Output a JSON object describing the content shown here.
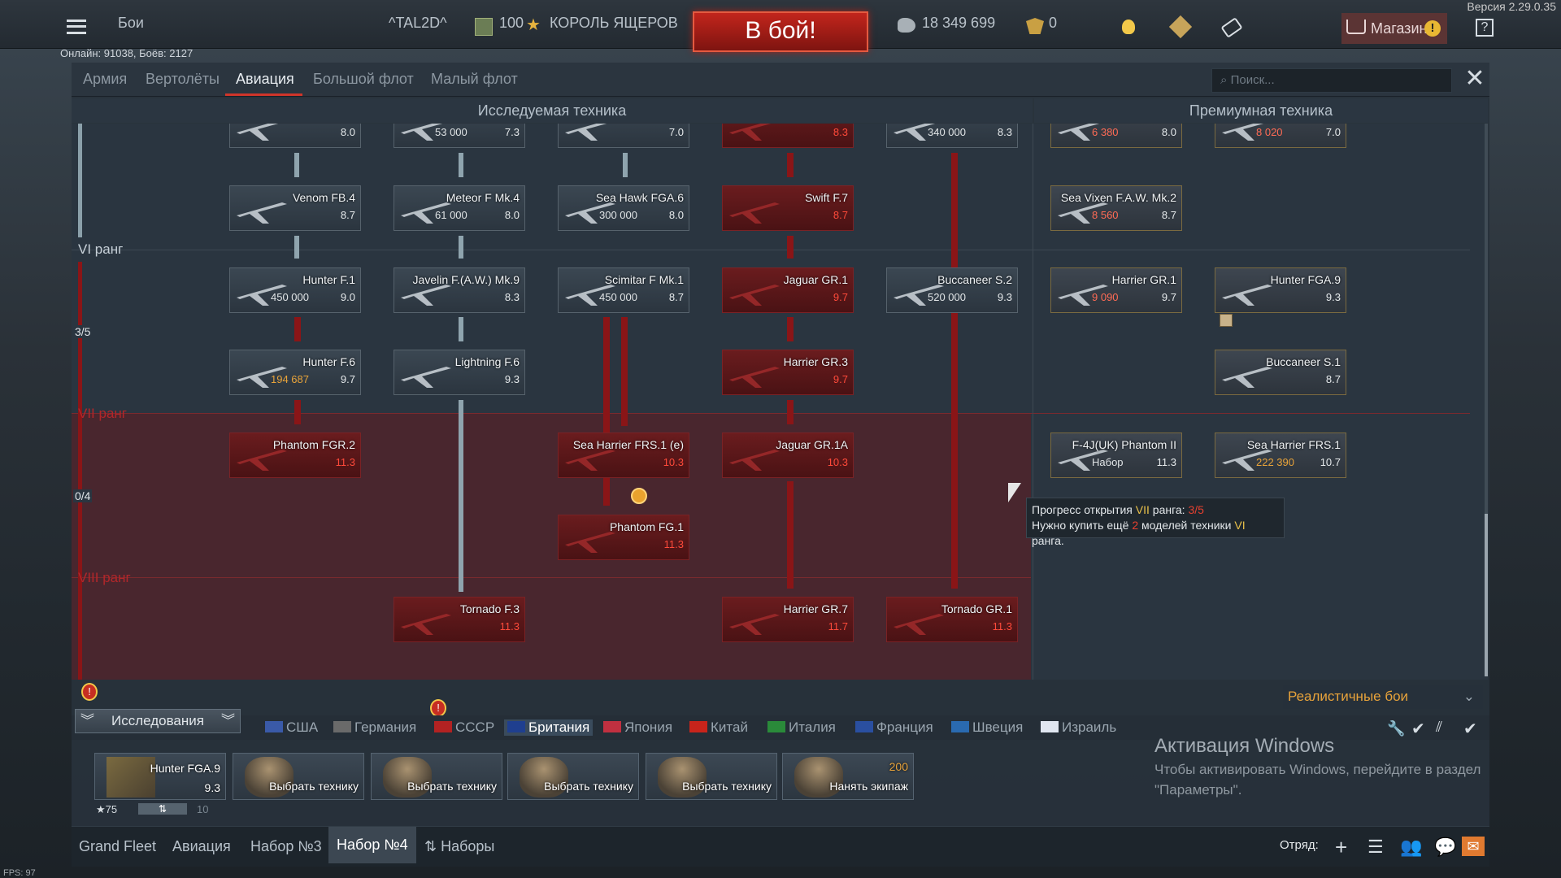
{
  "topbar": {
    "battles": "Бои",
    "nickname": "^TAL2D^",
    "level": "100",
    "title": "КОРОЛЬ ЯЩЕРОВ",
    "battle_button": "В бой!",
    "silver": "18 349 699",
    "gold": "0",
    "shop": "Магазин",
    "help": "?",
    "version": "Версия 2.29.0.35",
    "online": "Онлайн: 91038, Боёв: 2127"
  },
  "tabs": [
    "Армия",
    "Вертолёты",
    "Авиация",
    "Большой флот",
    "Малый флот"
  ],
  "active_tab": "Авиация",
  "search": {
    "placeholder": "Поиск..."
  },
  "sections": {
    "researched": "Исследуемая техника",
    "premium": "Премиумная техника"
  },
  "ranks": {
    "vi": "VI ранг",
    "vii": "VII ранг",
    "viii": "VIII ранг",
    "vi_progress": "3/5",
    "vii_progress": "0/4"
  },
  "cards": [
    {
      "id": "top1",
      "name": "",
      "cost": "",
      "br": "8.0",
      "red": false
    },
    {
      "id": "top2",
      "name": "",
      "cost": "53 000",
      "br": "7.3",
      "red": false
    },
    {
      "id": "top3",
      "name": "",
      "cost": "",
      "br": "7.0",
      "red": false
    },
    {
      "id": "top4",
      "name": "",
      "cost": "",
      "br": "8.3",
      "red": true
    },
    {
      "id": "top5",
      "name": "",
      "cost": "340 000",
      "br": "8.3",
      "red": false
    },
    {
      "id": "top6",
      "name": "",
      "cost": "6 380",
      "br": "8.0",
      "red": false
    },
    {
      "id": "top7",
      "name": "",
      "cost": "8 020",
      "br": "7.0",
      "red": false
    },
    {
      "id": "venom",
      "name": "Venom FB.4",
      "cost": "",
      "br": "8.7",
      "red": false
    },
    {
      "id": "meteor",
      "name": "Meteor F Mk.4",
      "cost": "61 000",
      "br": "8.0",
      "red": false
    },
    {
      "id": "seahawk",
      "name": "Sea Hawk FGA.6",
      "cost": "300 000",
      "br": "8.0",
      "red": false
    },
    {
      "id": "swift",
      "name": "Swift F.7",
      "cost": "",
      "br": "8.7",
      "red": true
    },
    {
      "id": "seavixen",
      "name": "Sea Vixen F.A.W. Mk.2",
      "cost": "8 560",
      "br": "8.7",
      "red": false
    },
    {
      "id": "hunterf1",
      "name": "Hunter F.1",
      "cost": "450 000",
      "br": "9.0",
      "red": false
    },
    {
      "id": "javelin",
      "name": "Javelin F.(A.W.) Mk.9",
      "cost": "",
      "br": "8.3",
      "red": false
    },
    {
      "id": "scimitar",
      "name": "Scimitar F Mk.1",
      "cost": "450 000",
      "br": "8.7",
      "red": false
    },
    {
      "id": "jaguar1",
      "name": "Jaguar GR.1",
      "cost": "",
      "br": "9.7",
      "red": true
    },
    {
      "id": "buccaneer2",
      "name": "Buccaneer S.2",
      "cost": "520 000",
      "br": "9.3",
      "red": false
    },
    {
      "id": "harriergr1",
      "name": "Harrier GR.1",
      "cost": "9 090",
      "br": "9.7",
      "red": false
    },
    {
      "id": "hunterfga9",
      "name": "Hunter FGA.9",
      "cost": "",
      "br": "9.3",
      "red": false
    },
    {
      "id": "hunterf6",
      "name": "Hunter F.6",
      "cost": "194 687",
      "br": "9.7",
      "red": false
    },
    {
      "id": "lightning",
      "name": "Lightning F.6",
      "cost": "",
      "br": "9.3",
      "red": false
    },
    {
      "id": "harriergr3",
      "name": "Harrier GR.3",
      "cost": "",
      "br": "9.7",
      "red": true
    },
    {
      "id": "buccaneer1",
      "name": "Buccaneer S.1",
      "cost": "",
      "br": "8.7",
      "red": false
    },
    {
      "id": "phantomfgr2",
      "name": "Phantom FGR.2",
      "cost": "",
      "br": "11.3",
      "red": true
    },
    {
      "id": "seaharriere",
      "name": "Sea Harrier FRS.1 (e)",
      "cost": "",
      "br": "10.3",
      "red": true
    },
    {
      "id": "jaguar1a",
      "name": "Jaguar GR.1A",
      "cost": "",
      "br": "10.3",
      "red": true
    },
    {
      "id": "f4j",
      "name": "F-4J(UK) Phantom II",
      "cost": "Набор",
      "br": "11.3",
      "red": false
    },
    {
      "id": "seaharrier",
      "name": "Sea Harrier FRS.1",
      "cost": "222 390",
      "br": "10.7",
      "red": false
    },
    {
      "id": "phantomfg1",
      "name": "Phantom FG.1",
      "cost": "",
      "br": "11.3",
      "red": true
    },
    {
      "id": "tornadof3",
      "name": "Tornado F.3",
      "cost": "",
      "br": "11.3",
      "red": true
    },
    {
      "id": "harriergr7",
      "name": "Harrier GR.7",
      "cost": "",
      "br": "11.7",
      "red": true
    },
    {
      "id": "tornadogr1",
      "name": "Tornado GR.1",
      "cost": "",
      "br": "11.3",
      "red": true
    }
  ],
  "tooltip": {
    "line1_a": "Прогресс открытия ",
    "line1_rank": "VII",
    "line1_b": " ранга: ",
    "line1_val": "3/5",
    "line2_a": "Нужно купить ещё ",
    "line2_num": "2",
    "line2_b": " моделей техники ",
    "line2_rank": "VI",
    "line2_c": " ранга."
  },
  "mode": "Реалистичные бои",
  "research_button": "Исследования",
  "countries": [
    "США",
    "Германия",
    "СССР",
    "Британия",
    "Япония",
    "Китай",
    "Италия",
    "Франция",
    "Швеция",
    "Израиль"
  ],
  "active_country": "Британия",
  "crew": [
    {
      "name": "Hunter FGA.9",
      "br": "9.3",
      "extra": "75",
      "extra2": "10"
    },
    {
      "name": "Выбрать технику"
    },
    {
      "name": "Выбрать технику"
    },
    {
      "name": "Выбрать технику"
    },
    {
      "name": "Выбрать технику"
    },
    {
      "name": "Нанять экипаж",
      "cost": "200"
    }
  ],
  "bottom_tabs": [
    "Grand Fleet",
    "Авиация",
    "Набор №3",
    "Набор №4",
    "Наборы"
  ],
  "active_bottom": "Набор №4",
  "squad": "Отряд:",
  "windows": {
    "title": "Активация Windows",
    "text": "Чтобы активировать Windows, перейдите в раздел \"Параметры\"."
  },
  "fps": "FPS: 97",
  "colors": {
    "accent": "#d0352a",
    "gold": "#e8a33a",
    "locked": "#6a1c1e"
  }
}
